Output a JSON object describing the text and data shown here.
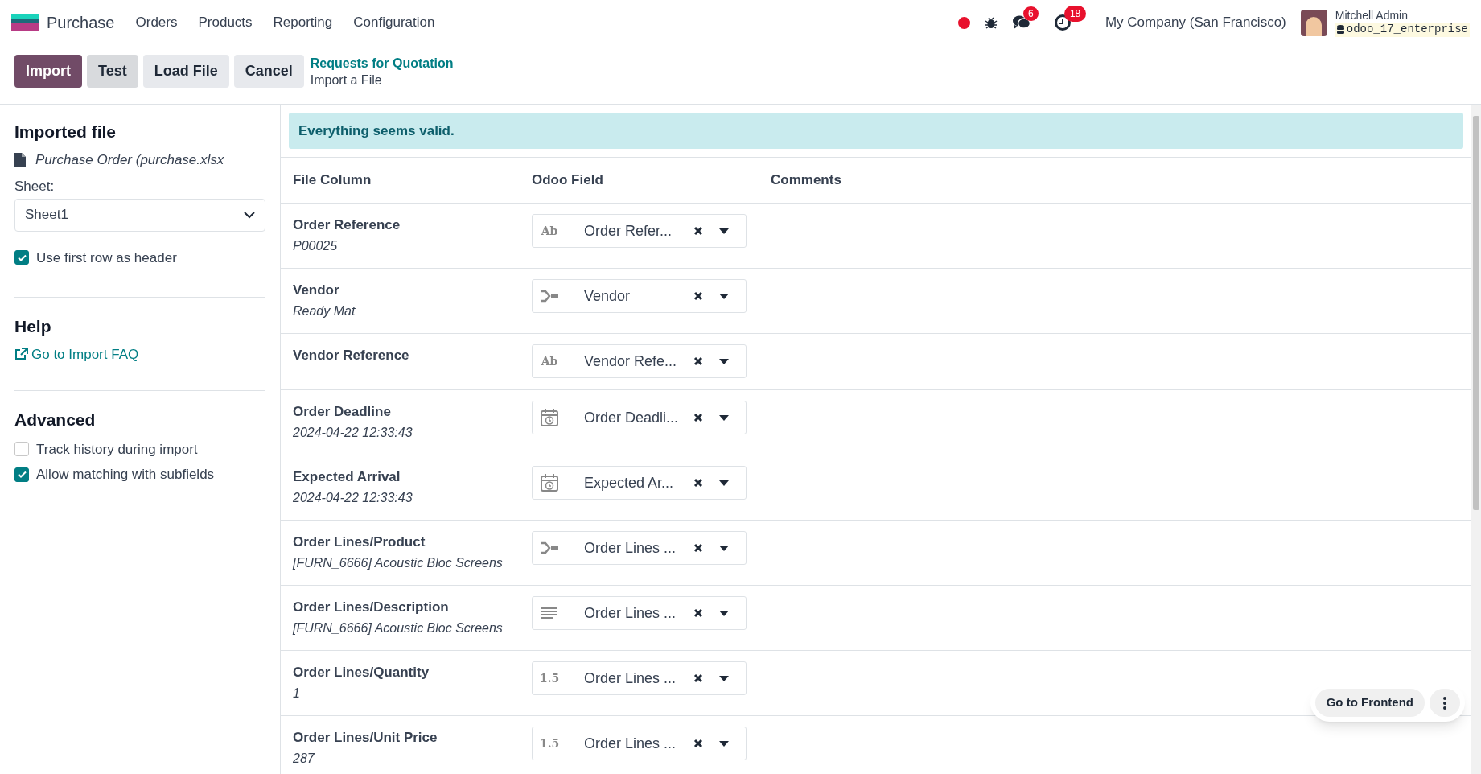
{
  "navbar": {
    "app_name": "Purchase",
    "menu": [
      "Orders",
      "Products",
      "Reporting",
      "Configuration"
    ],
    "messages_count": "6",
    "activities_count": "18",
    "company": "My Company (San Francisco)",
    "user_name": "Mitchell Admin",
    "database": "odoo_17_enterprise"
  },
  "control_panel": {
    "buttons": [
      {
        "label": "Import",
        "kind": "primary"
      },
      {
        "label": "Test",
        "kind": "secondary"
      },
      {
        "label": "Load File",
        "kind": "light"
      },
      {
        "label": "Cancel",
        "kind": "light"
      }
    ],
    "breadcrumb": "Requests for Quotation",
    "page_title": "Import a File"
  },
  "sidebar": {
    "imported_file_title": "Imported file",
    "file_name": "Purchase Order (purchase.xlsx",
    "sheet_label": "Sheet:",
    "sheet_value": "Sheet1",
    "header_option": {
      "label": "Use first row as header",
      "checked": true
    },
    "help_title": "Help",
    "faq_link": "Go to Import FAQ",
    "advanced_title": "Advanced",
    "advanced_options": [
      {
        "label": "Track history during import",
        "checked": false
      },
      {
        "label": "Allow matching with subfields",
        "checked": true
      }
    ]
  },
  "alert": "Everything seems valid.",
  "table": {
    "columns": [
      "File Column",
      "Odoo Field",
      "Comments"
    ],
    "rows": [
      {
        "column": "Order Reference",
        "sample": "P00025",
        "field": "Order Refer...",
        "kind": "text",
        "type_label": "Ab"
      },
      {
        "column": "Vendor",
        "sample": "Ready Mat",
        "field": "Vendor",
        "kind": "relation"
      },
      {
        "column": "Vendor Reference",
        "field": "Vendor Refe...",
        "kind": "text",
        "type_label": "Ab"
      },
      {
        "column": "Order Deadline",
        "sample": "2024-04-22 12:33:43",
        "field": "Order Deadli...",
        "kind": "date"
      },
      {
        "column": "Expected Arrival",
        "sample": "2024-04-22 12:33:43",
        "field": "Expected Ar...",
        "kind": "date"
      },
      {
        "column": "Order Lines/Product",
        "sample": "[FURN_6666] Acoustic Bloc Screens",
        "field": "Order Lines ...",
        "kind": "relation"
      },
      {
        "column": "Order Lines/Description",
        "sample": "[FURN_6666] Acoustic Bloc Screens",
        "field": "Order Lines ...",
        "kind": "lines"
      },
      {
        "column": "Order Lines/Quantity",
        "sample": "1",
        "field": "Order Lines ...",
        "kind": "number",
        "type_label": "1.5"
      },
      {
        "column": "Order Lines/Unit Price",
        "sample": "287",
        "field": "Order Lines ...",
        "kind": "number",
        "type_label": "1.5"
      }
    ]
  },
  "floating": {
    "frontend_button": "Go to Frontend"
  }
}
